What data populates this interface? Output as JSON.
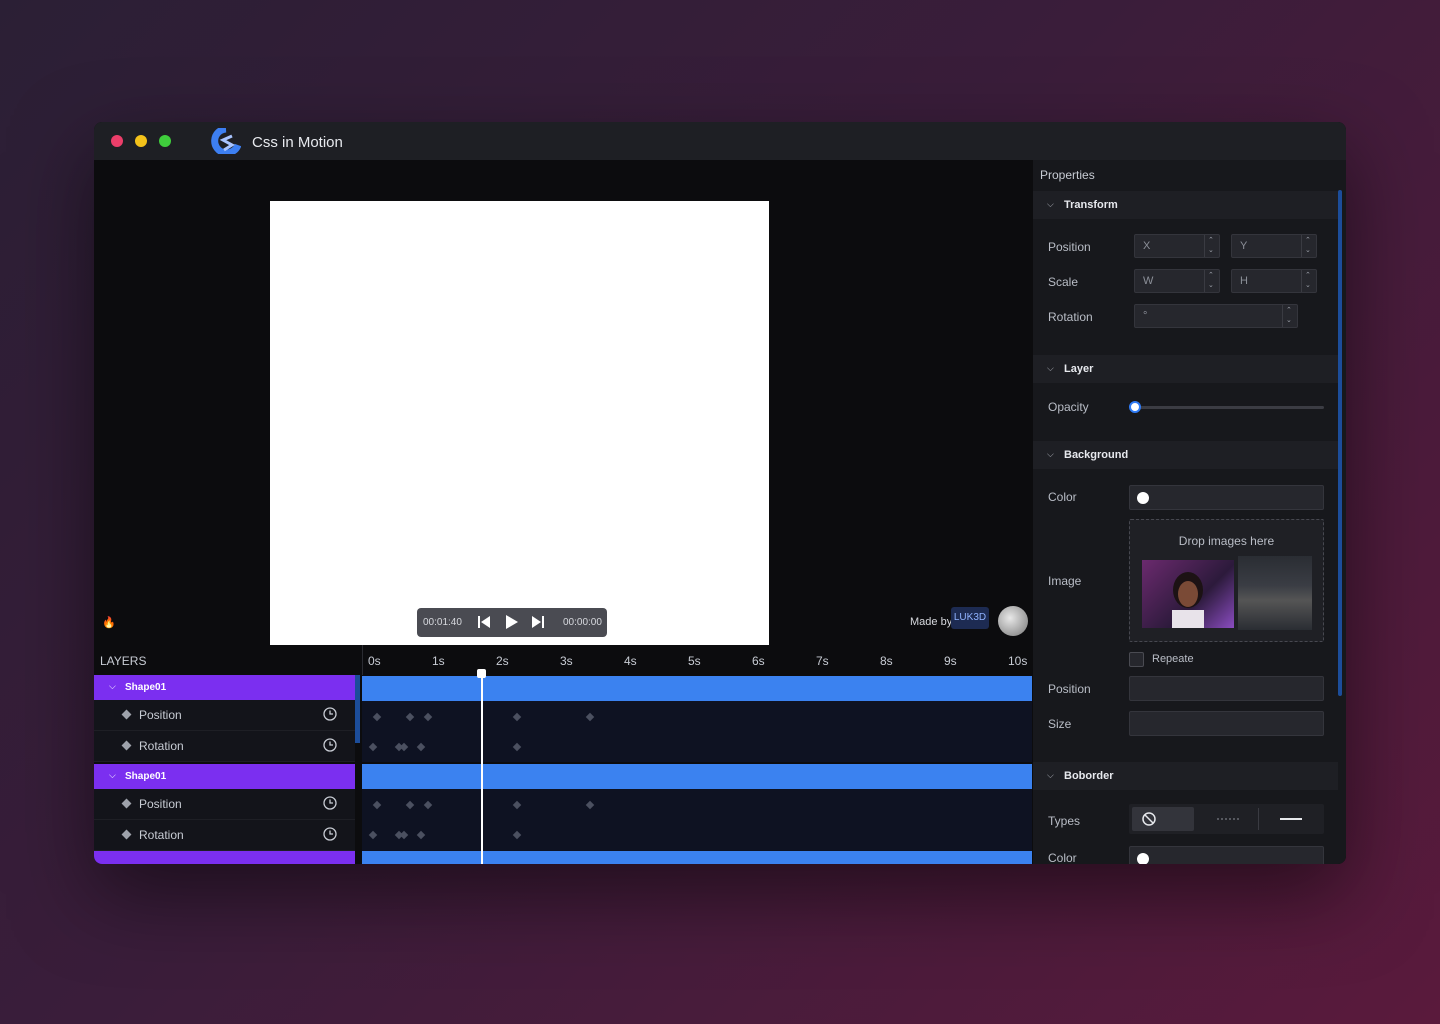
{
  "app": {
    "title": "Css in Motion"
  },
  "player": {
    "current_time": "00:01:40",
    "end_time": "00:00:00"
  },
  "credits": {
    "made_by": "Made by",
    "author": "LUK3D"
  },
  "timeline": {
    "header": "LAYERS",
    "ticks": [
      "0s",
      "1s",
      "2s",
      "3s",
      "4s",
      "5s",
      "6s",
      "7s",
      "8s",
      "9s",
      "10s"
    ],
    "layers": [
      {
        "name": "Shape01",
        "props": [
          "Position",
          "Rotation"
        ]
      },
      {
        "name": "Shape01",
        "props": [
          "Position",
          "Rotation"
        ]
      }
    ]
  },
  "properties": {
    "title": "Properties",
    "transform": {
      "title": "Transform",
      "position_label": "Position",
      "x_placeholder": "X",
      "y_placeholder": "Y",
      "scale_label": "Scale",
      "w_placeholder": "W",
      "h_placeholder": "H",
      "rotation_label": "Rotation",
      "rotation_placeholder": "°"
    },
    "layer": {
      "title": "Layer",
      "opacity_label": "Opacity",
      "opacity": 0
    },
    "background": {
      "title": "Background",
      "color_label": "Color",
      "color": "#ffffff",
      "image_label": "Image",
      "drop_text": "Drop images here",
      "repeat_label": "Repeate",
      "position_label": "Position",
      "size_label": "Size"
    },
    "border": {
      "title": "Boborder",
      "types_label": "Types",
      "color_label": "Color",
      "color": "#ffffff"
    }
  },
  "colors": {
    "accent_blue": "#3b82f0",
    "layer_purple": "#7b2ff0"
  }
}
